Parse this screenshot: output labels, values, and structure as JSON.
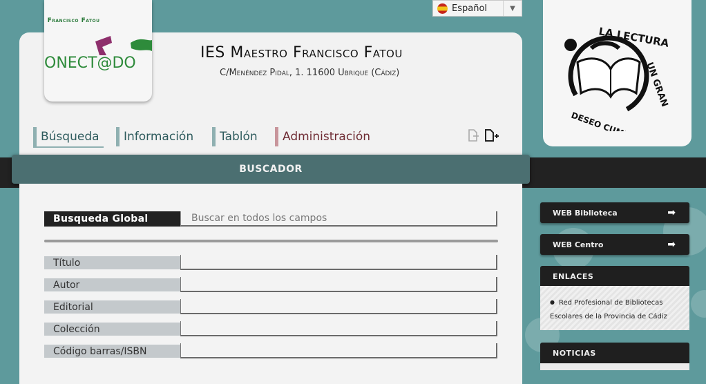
{
  "language": {
    "selected": "Español"
  },
  "header": {
    "logo_school_text": "S Francisco Fatou",
    "logo_brand_text": "ONECT@DO",
    "title": "IES Maestro Francisco Fatou",
    "address": "C/Menéndez Pidal, 1. 11600 Ubrique (Cádiz)"
  },
  "nav": {
    "items": [
      {
        "label": "Búsqueda"
      },
      {
        "label": "Información"
      },
      {
        "label": "Tablón"
      },
      {
        "label": "Administración"
      }
    ]
  },
  "search": {
    "title": "BUSCADOR",
    "global_label": "Busqueda Global",
    "global_placeholder": "Buscar en todos los campos",
    "fields": [
      {
        "label": "Título"
      },
      {
        "label": "Autor"
      },
      {
        "label": "Editorial"
      },
      {
        "label": "Colección"
      },
      {
        "label": "Código barras/ISBN"
      }
    ]
  },
  "sidebar": {
    "logo_text": "LA LECTURA UN GRAN DESEO CUMPLIDO",
    "buttons": [
      {
        "label": "WEB Biblioteca"
      },
      {
        "label": "WEB Centro"
      }
    ],
    "enlaces": {
      "title": "ENLACES",
      "items": [
        "Red Profesional de Bibliotecas Escolares de la Provincia de Cádiz"
      ]
    },
    "noticias": {
      "title": "NOTICIAS"
    }
  },
  "colors": {
    "background": "#5e9a9c",
    "nav_teal": "#2e5b5d",
    "nav_admin": "#6e2b33",
    "buscador_bar": "#4b6f71",
    "dark": "#1f1f1f"
  }
}
